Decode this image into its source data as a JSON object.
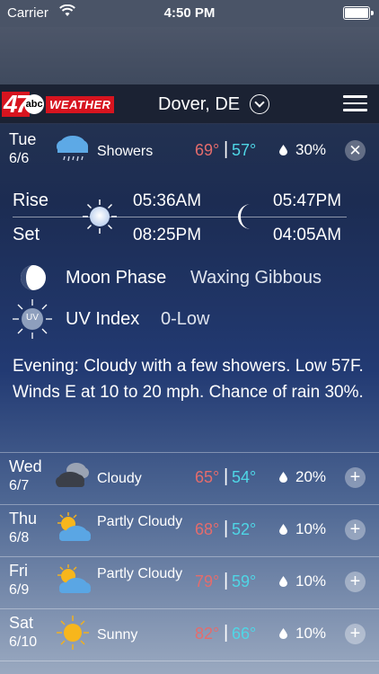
{
  "status_bar": {
    "carrier": "Carrier",
    "time": "4:50 PM"
  },
  "header": {
    "logo_number": "47",
    "logo_network": "abc",
    "logo_word": "WEATHER",
    "location": "Dover, DE"
  },
  "selected_day": {
    "day": "Tue",
    "date": "6/6",
    "condition": "Showers",
    "icon": "showers-icon",
    "high": "69°",
    "low": "57°",
    "separator": "|",
    "precip": "30%",
    "sun": {
      "rise_label": "Rise",
      "set_label": "Set",
      "sunrise": "05:36AM",
      "sunset": "08:25PM",
      "moonrise": "05:47PM",
      "moonset": "04:05AM"
    },
    "moon_phase_label": "Moon Phase",
    "moon_phase": "Waxing Gibbous",
    "uv_label": "UV Index",
    "uv_icon_text": "UV",
    "uv_value": "0-Low",
    "forecast": "Evening: Cloudy with a few showers. Low 57F. Winds E at 10 to 20 mph. Chance of rain 30%."
  },
  "days": [
    {
      "day": "Wed",
      "date": "6/7",
      "condition": "Cloudy",
      "icon": "cloudy-icon",
      "high": "65°",
      "low": "54°",
      "separator": "|",
      "precip": "20%"
    },
    {
      "day": "Thu",
      "date": "6/8",
      "condition": "Partly Cloudy",
      "icon": "partly-cloudy-icon",
      "high": "68°",
      "low": "52°",
      "separator": "|",
      "precip": "10%"
    },
    {
      "day": "Fri",
      "date": "6/9",
      "condition": "Partly Cloudy",
      "icon": "partly-cloudy-icon",
      "high": "79°",
      "low": "59°",
      "separator": "|",
      "precip": "10%"
    },
    {
      "day": "Sat",
      "date": "6/10",
      "condition": "Sunny",
      "icon": "sunny-icon",
      "high": "82°",
      "low": "66°",
      "separator": "|",
      "precip": "10%"
    }
  ],
  "colors": {
    "high_temp": "#e46c6c",
    "low_temp": "#4fd6e6",
    "brand_red": "#d7141f"
  }
}
